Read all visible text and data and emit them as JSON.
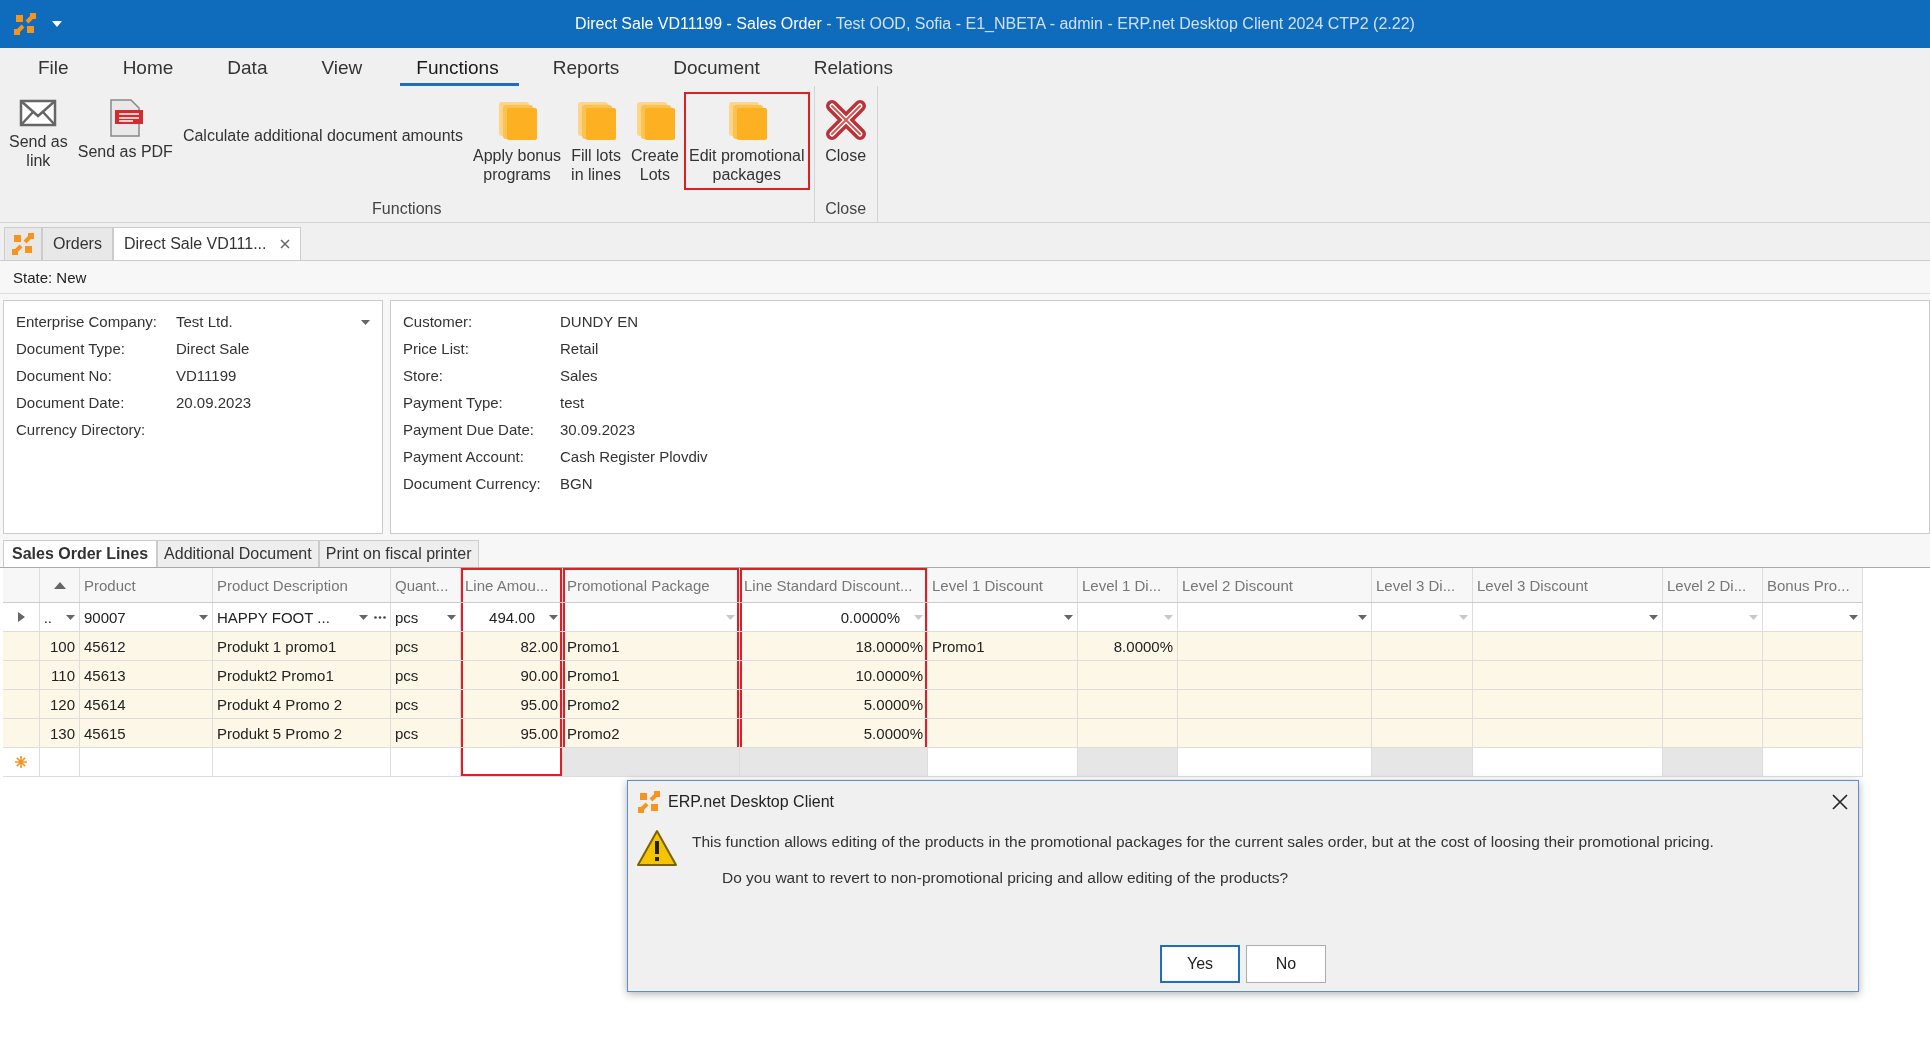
{
  "window": {
    "document_title": "Direct Sale VD11199 - Sales Order",
    "app_info": " - Test OOD, Sofia - E1_NBETA - admin - ERP.net Desktop Client 2024 CTP2 (2.22)"
  },
  "menu": [
    {
      "label": "File",
      "selected": false
    },
    {
      "label": "Home",
      "selected": false
    },
    {
      "label": "Data",
      "selected": false
    },
    {
      "label": "View",
      "selected": false
    },
    {
      "label": "Functions",
      "selected": true
    },
    {
      "label": "Reports",
      "selected": false
    },
    {
      "label": "Document",
      "selected": false
    },
    {
      "label": "Relations",
      "selected": false
    }
  ],
  "ribbon_groups": [
    {
      "label": "Functions",
      "buttons": [
        {
          "kind": "envelope",
          "label": "Send as\nlink",
          "highlighted": false
        },
        {
          "kind": "pdf",
          "label": "Send as PDF",
          "highlighted": false
        },
        {
          "kind": "text",
          "label": "Calculate additional document amounts",
          "highlighted": false
        },
        {
          "kind": "folder",
          "label": "Apply bonus\nprograms",
          "highlighted": false
        },
        {
          "kind": "folder",
          "label": "Fill lots\nin lines",
          "highlighted": false
        },
        {
          "kind": "folder",
          "label": "Create\nLots",
          "highlighted": false
        },
        {
          "kind": "folder",
          "label": "Edit promotional\npackages",
          "highlighted": true
        }
      ]
    },
    {
      "label": "Close",
      "buttons": [
        {
          "kind": "close",
          "label": "Close",
          "highlighted": false
        }
      ]
    }
  ],
  "doc_tabs": [
    {
      "label": "Orders",
      "selected": false,
      "closable": false
    },
    {
      "label": "Direct Sale VD111...",
      "selected": true,
      "closable": true
    }
  ],
  "state": "State: New",
  "left_fields": [
    {
      "label": "Enterprise Company:",
      "value": "Test Ltd.",
      "dropdown": true
    },
    {
      "label": "Document Type:",
      "value": "Direct Sale",
      "dropdown": false
    },
    {
      "label": "Document No:",
      "value": "VD11199",
      "dropdown": false
    },
    {
      "label": "Document Date:",
      "value": "20.09.2023",
      "dropdown": false
    },
    {
      "label": "Currency Directory:"
    }
  ],
  "right_fields": [
    {
      "label": "Customer:",
      "value": "DUNDY EN"
    },
    {
      "label": "Price List:",
      "value": "Retail"
    },
    {
      "label": "Store:",
      "value": "Sales"
    },
    {
      "label": "Payment Type:",
      "value": "test"
    },
    {
      "label": "Payment Due Date:",
      "value": "30.09.2023"
    },
    {
      "label": "Payment Account:",
      "value": "Cash Register Plovdiv"
    },
    {
      "label": "Document Currency:",
      "value": "BGN"
    }
  ],
  "grid_tabs": [
    {
      "label": "Sales Order Lines",
      "selected": true
    },
    {
      "label": "Additional Document",
      "selected": false
    },
    {
      "label": "Print on fiscal printer",
      "selected": false
    }
  ],
  "table": {
    "columns": [
      {
        "sorted": true,
        "readonly": false,
        "highlighted": false
      },
      {
        "header": "Product",
        "readonly": false,
        "highlighted": false
      },
      {
        "header": "Product Description",
        "readonly": false,
        "highlighted": false
      },
      {
        "header": "Quant...",
        "readonly": false,
        "highlighted": false
      },
      {
        "header": "Line Amou...",
        "readonly": false,
        "highlighted": true
      },
      {
        "header": "Promotional Package",
        "readonly": true,
        "highlighted": true
      },
      {
        "header": "Line Standard Discount...",
        "readonly": true,
        "highlighted": true
      },
      {
        "header": "Level 1 Discount",
        "readonly": false,
        "highlighted": false
      },
      {
        "header": "Level 1 Di...",
        "readonly": true,
        "highlighted": false
      },
      {
        "header": "Level 2 Discount",
        "readonly": false,
        "highlighted": false
      },
      {
        "header": "Level 3 Di...",
        "readonly": true,
        "highlighted": false
      },
      {
        "header": "Level 3 Discount",
        "readonly": false,
        "highlighted": false
      },
      {
        "header": "Level 2 Di...",
        "readonly": true,
        "highlighted": false
      },
      {
        "header": "Bonus Pro...",
        "readonly": false,
        "highlighted": false
      }
    ],
    "rows": [
      {
        "kind": "current",
        "selected": true,
        "cells": [
          "..",
          "90007",
          "HAPPY FOOT ...",
          "pcs",
          "494.00",
          null,
          "0.0000%",
          null,
          null,
          null,
          null,
          null,
          null,
          null
        ]
      },
      {
        "kind": "line",
        "selected": false,
        "cells": [
          "100",
          "45612",
          "Produkt 1 promo1",
          "pcs",
          "82.00",
          "Promo1",
          "18.0000%",
          "Promo1",
          "8.0000%",
          null,
          null,
          null,
          null,
          null
        ]
      },
      {
        "kind": "line",
        "selected": false,
        "cells": [
          "110",
          "45613",
          "Produkt2 Promo1",
          "pcs",
          "90.00",
          "Promo1",
          "10.0000%",
          null,
          null,
          null,
          null,
          null,
          null,
          null
        ]
      },
      {
        "kind": "line",
        "selected": false,
        "cells": [
          "120",
          "45614",
          "Produkt 4 Promo 2",
          "pcs",
          "95.00",
          "Promo2",
          "5.0000%",
          null,
          null,
          null,
          null,
          null,
          null,
          null
        ]
      },
      {
        "kind": "line",
        "selected": false,
        "cells": [
          "130",
          "45615",
          "Produkt 5 Promo 2",
          "pcs",
          "95.00",
          "Promo2",
          "5.0000%",
          null,
          null,
          null,
          null,
          null,
          null,
          null
        ]
      },
      {
        "kind": "new",
        "selected": false
      }
    ]
  },
  "dialog": {
    "title": "ERP.net Desktop Client",
    "message": "This function allows editing of the products in the promotional packages for the current sales order, but at the cost of loosing their promotional pricing.",
    "question": "Do you want to revert to non-promotional pricing and allow editing of the products?",
    "buttons": [
      {
        "label": "Yes",
        "selected": true
      },
      {
        "label": "No",
        "selected": false
      }
    ]
  }
}
